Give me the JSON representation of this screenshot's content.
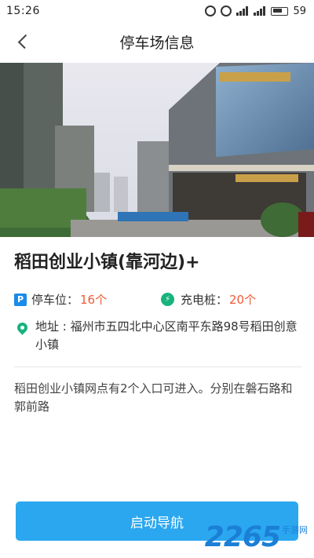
{
  "status_bar": {
    "time": "15:26",
    "battery": "59"
  },
  "header": {
    "title": "停车场信息"
  },
  "lot": {
    "name": "稻田创业小镇(靠河边)+",
    "parking_label": "停车位：",
    "parking_value": "16个",
    "charger_label": "充电桩：",
    "charger_value": "20个",
    "address": "地址 : 福州市五四北中心区南平东路98号稻田创意小镇",
    "description": "稻田创业小镇网点有2个入口可进入。分别在磐石路和郭前路"
  },
  "icons": {
    "parking": "P",
    "charger": "plug-icon"
  },
  "actions": {
    "navigate_label": "启动导航"
  },
  "watermark": {
    "number": "2265",
    "text": "手游网"
  },
  "colors": {
    "accent": "#2aa7ef",
    "value_orange": "#ee5a35",
    "parking_blue": "#1a8be8",
    "charger_green": "#19b27d"
  }
}
